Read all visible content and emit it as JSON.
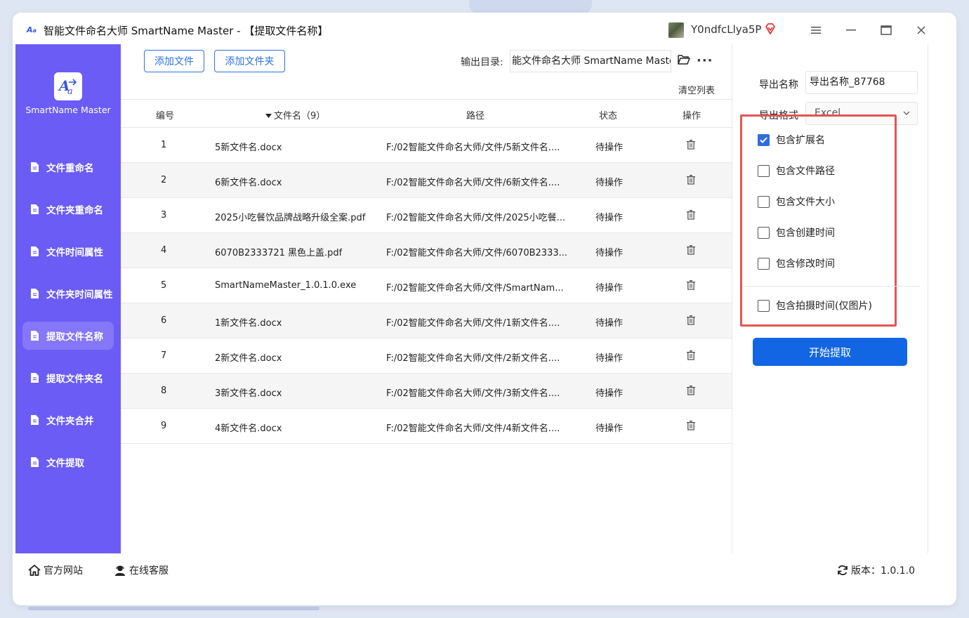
{
  "window": {
    "title": "智能文件命名大师 SmartName Master - 【提取文件名称】",
    "username": "Y0ndfcLlya5P"
  },
  "sidebar": {
    "brand": "SmartName Master",
    "items": [
      {
        "label": "文件重命名",
        "active": false
      },
      {
        "label": "文件夹重命名",
        "active": false
      },
      {
        "label": "文件时间属性",
        "active": false
      },
      {
        "label": "文件夹时间属性",
        "active": false
      },
      {
        "label": "提取文件名称",
        "active": true
      },
      {
        "label": "提取文件夹名",
        "active": false
      },
      {
        "label": "文件夹合并",
        "active": false
      },
      {
        "label": "文件提取",
        "active": false
      }
    ]
  },
  "toolbar": {
    "add_file": "添加文件",
    "add_folder": "添加文件夹",
    "output_label": "输出目录:",
    "output_path": "能文件命名大师 SmartName Master",
    "more": "···",
    "clear_list": "清空列表"
  },
  "table": {
    "headers": {
      "index": "编号",
      "name": "文件名（9）",
      "path": "路径",
      "status": "状态",
      "action": "操作"
    },
    "rows": [
      {
        "index": "1",
        "name": "5新文件名.docx",
        "path": "F:/02智能文件命名大师/文件/5新文件名....",
        "status": "待操作"
      },
      {
        "index": "2",
        "name": "6新文件名.docx",
        "path": "F:/02智能文件命名大师/文件/6新文件名....",
        "status": "待操作"
      },
      {
        "index": "3",
        "name": "2025小吃餐饮品牌战略升级全案.pdf",
        "path": "F:/02智能文件命名大师/文件/2025小吃餐...",
        "status": "待操作"
      },
      {
        "index": "4",
        "name": "6070B2333721 黑色上盖.pdf",
        "path": "F:/02智能文件命名大师/文件/6070B2333...",
        "status": "待操作"
      },
      {
        "index": "5",
        "name": "SmartNameMaster_1.0.1.0.exe",
        "path": "F:/02智能文件命名大师/文件/SmartNam...",
        "status": "待操作"
      },
      {
        "index": "6",
        "name": "1新文件名.docx",
        "path": "F:/02智能文件命名大师/文件/1新文件名....",
        "status": "待操作"
      },
      {
        "index": "7",
        "name": "2新文件名.docx",
        "path": "F:/02智能文件命名大师/文件/2新文件名....",
        "status": "待操作"
      },
      {
        "index": "8",
        "name": "3新文件名.docx",
        "path": "F:/02智能文件命名大师/文件/3新文件名....",
        "status": "待操作"
      },
      {
        "index": "9",
        "name": "4新文件名.docx",
        "path": "F:/02智能文件命名大师/文件/4新文件名....",
        "status": "待操作"
      }
    ]
  },
  "options": {
    "export_name_label": "导出名称",
    "export_name_value": "导出名称_87768",
    "export_format_label": "导出格式",
    "export_format_value": "Excel",
    "checkboxes": [
      {
        "label": "包含扩展名",
        "checked": true
      },
      {
        "label": "包含文件路径",
        "checked": false
      },
      {
        "label": "包含文件大小",
        "checked": false
      },
      {
        "label": "包含创建时间",
        "checked": false
      },
      {
        "label": "包含修改时间",
        "checked": false
      },
      {
        "label": "包含拍摄时间(仅图片)",
        "checked": false
      }
    ],
    "start_button": "开始提取"
  },
  "footer": {
    "website": "官方网站",
    "support": "在线客服",
    "version": "版本：1.0.1.0"
  },
  "colors": {
    "sidebar_bg": "#6b5cf6",
    "sidebar_active": "#8577f7",
    "primary": "#1266e3",
    "highlight_border": "#e55353"
  }
}
